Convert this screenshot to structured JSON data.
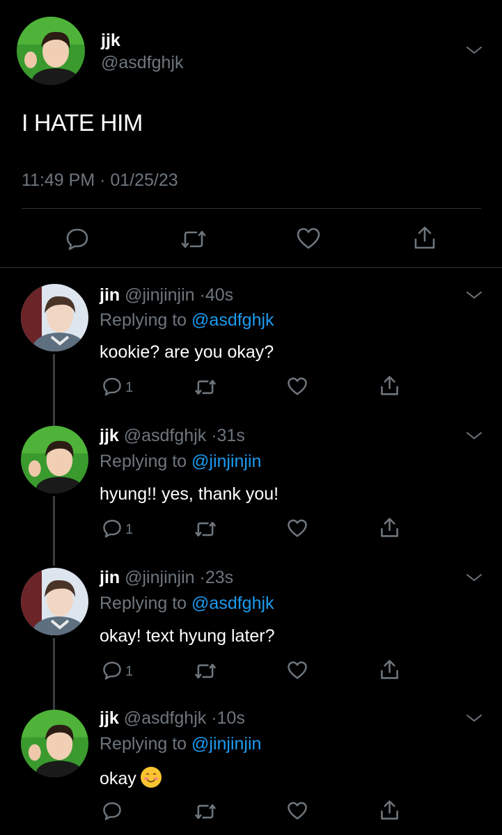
{
  "main_tweet": {
    "author_name": "jjk",
    "author_handle": "@asdfghjk",
    "text": "I HATE HIM",
    "timestamp": "11:49 PM · 01/25/23",
    "actions": [
      "reply-icon",
      "retweet-icon",
      "like-icon",
      "share-icon"
    ]
  },
  "replies": [
    {
      "author_name": "jin",
      "author_handle": "@jinjinjin",
      "separator": "·",
      "time": "40s",
      "replying_prefix": "Replying to",
      "replying_to": "@asdfghjk",
      "text": "kookie? are you okay?",
      "reply_count": "1"
    },
    {
      "author_name": "jjk",
      "author_handle": "@asdfghjk",
      "separator": "·",
      "time": "31s",
      "replying_prefix": "Replying to",
      "replying_to": "@jinjinjin",
      "text": "hyung!! yes, thank you!",
      "reply_count": "1"
    },
    {
      "author_name": "jin",
      "author_handle": "@jinjinjin",
      "separator": "·",
      "time": "23s",
      "replying_prefix": "Replying to",
      "replying_to": "@asdfghjk",
      "text": "okay! text hyung later?",
      "reply_count": "1"
    },
    {
      "author_name": "jjk",
      "author_handle": "@asdfghjk",
      "separator": "·",
      "time": "10s",
      "replying_prefix": "Replying to",
      "replying_to": "@jinjinjin",
      "text": "okay",
      "emoji": "smiling-face-icon",
      "reply_count": ""
    }
  ],
  "colors": {
    "background": "#000000",
    "primary_text": "#ffffff",
    "secondary_text": "#6e767d",
    "mention": "#1d9bf0",
    "divider": "#2f3336"
  }
}
